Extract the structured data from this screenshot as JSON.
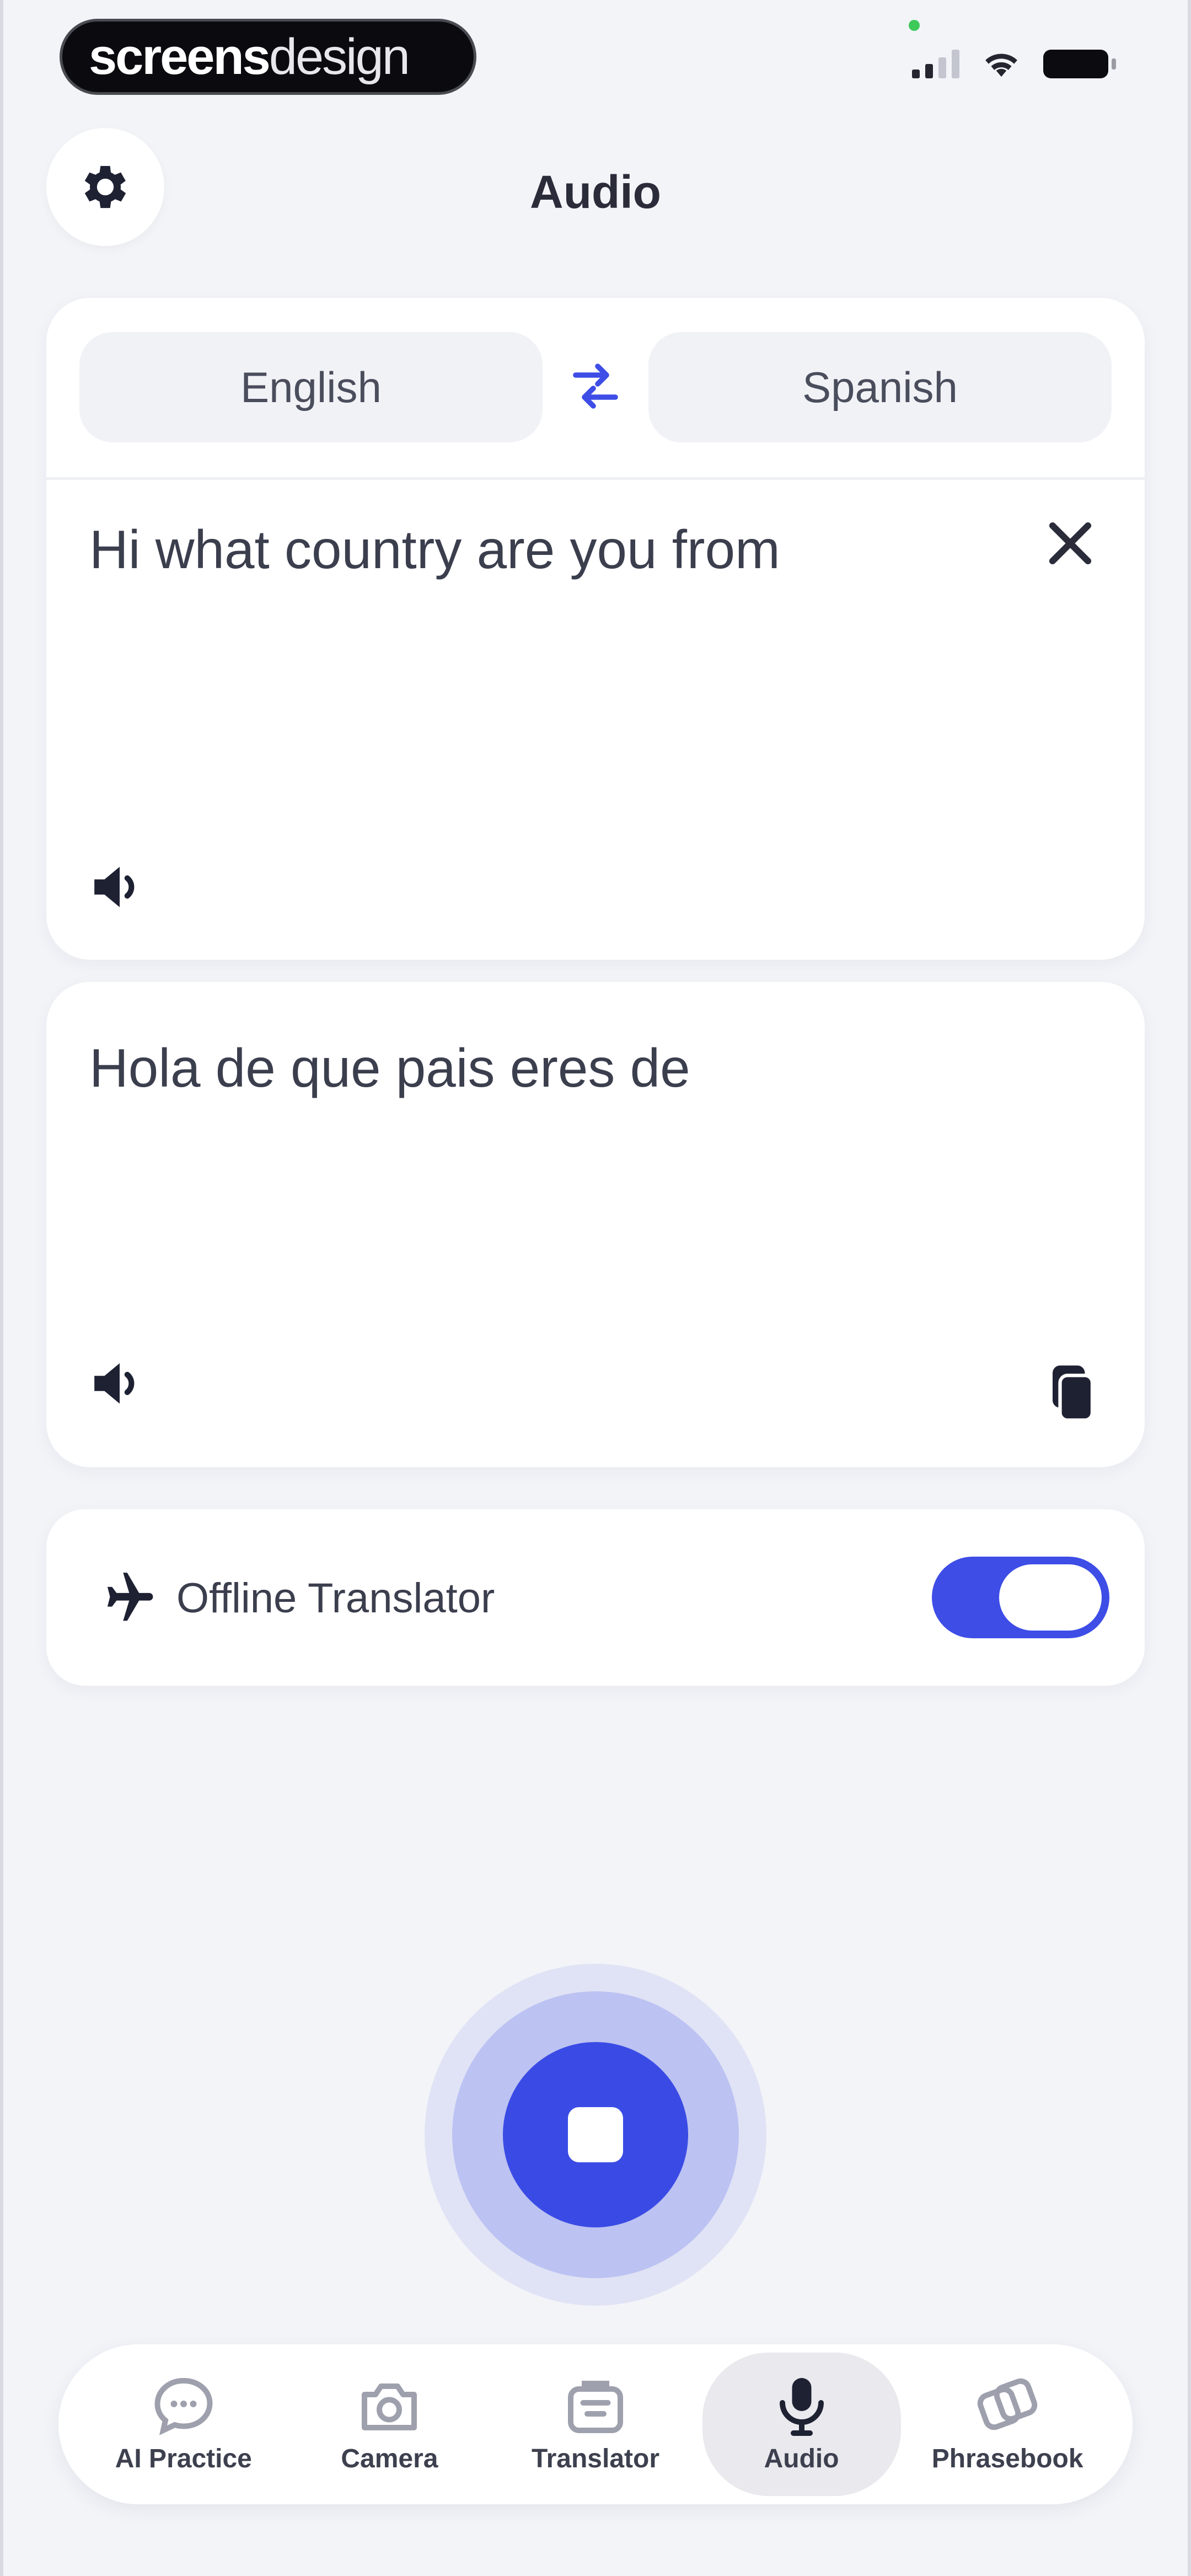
{
  "status_bar": {
    "brand_bold": "screens",
    "brand_light": "design"
  },
  "header": {
    "title": "Audio",
    "settings_icon": "gear-icon"
  },
  "languages": {
    "source": "English",
    "target": "Spanish",
    "swap_icon": "swap-arrows-icon"
  },
  "source": {
    "text": "Hi what country are you from",
    "clear_icon": "close-icon",
    "speak_icon": "speaker-icon"
  },
  "translation": {
    "text": "Hola de que pais eres de",
    "speak_icon": "speaker-icon",
    "copy_icon": "copy-icon"
  },
  "offline": {
    "label": "Offline Translator",
    "icon": "airplane-icon",
    "enabled": true
  },
  "record": {
    "state": "recording",
    "icon": "stop-icon"
  },
  "tabs": [
    {
      "label": "AI Practice",
      "icon": "chat-bubble-icon",
      "active": false
    },
    {
      "label": "Camera",
      "icon": "camera-icon",
      "active": false
    },
    {
      "label": "Translator",
      "icon": "translator-icon",
      "active": false
    },
    {
      "label": "Audio",
      "icon": "microphone-icon",
      "active": true
    },
    {
      "label": "Phrasebook",
      "icon": "phrasebook-icon",
      "active": false
    }
  ],
  "colors": {
    "accent": "#3a4be5",
    "background": "#f3f4f8",
    "text": "#3b3e4d"
  }
}
